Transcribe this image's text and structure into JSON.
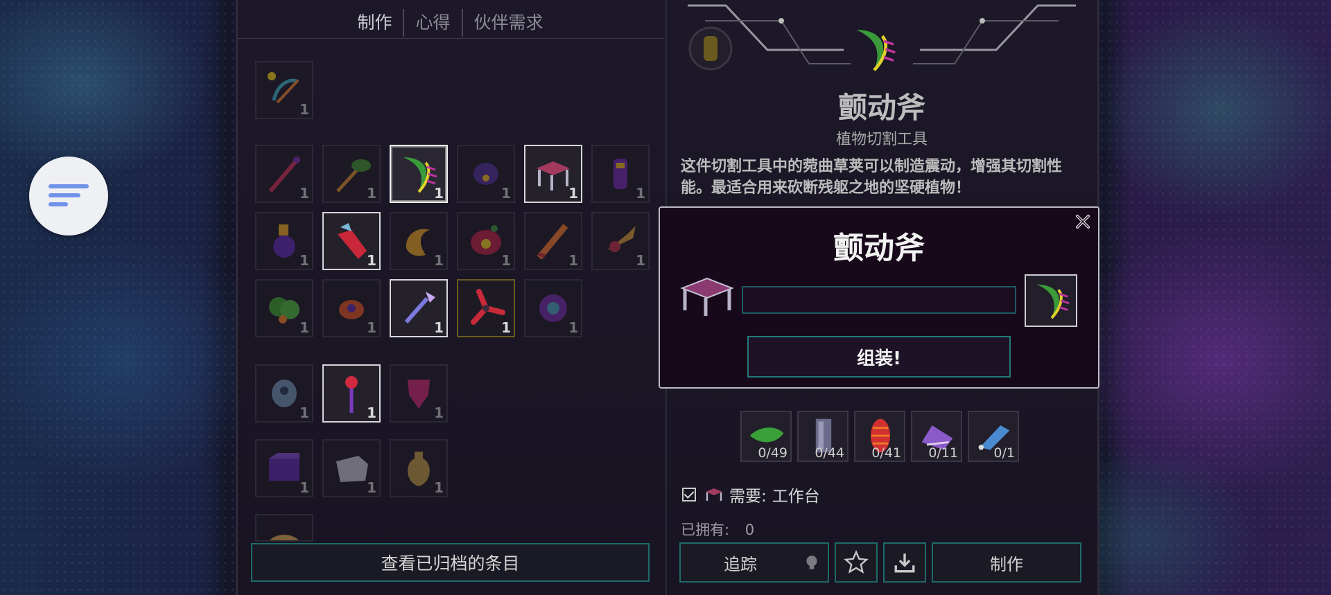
{
  "tabs": [
    {
      "label": "制作",
      "active": true
    },
    {
      "label": "心得",
      "active": false
    },
    {
      "label": "伙伴需求",
      "active": false
    }
  ],
  "recipe_grid": {
    "slots": [
      {
        "icon": "bow-icon",
        "count": "1"
      },
      {
        "icon": "staff-icon",
        "count": "1"
      },
      {
        "icon": "pickaxe-icon",
        "count": "1"
      },
      {
        "icon": "tremor-axe-icon",
        "count": "1"
      },
      {
        "icon": "purple-flower-icon",
        "count": "1"
      },
      {
        "icon": "workbench-icon",
        "count": "1"
      },
      {
        "icon": "purple-totem-icon",
        "count": "1"
      },
      {
        "icon": "purple-lantern-icon",
        "count": "1"
      },
      {
        "icon": "red-boot-icon",
        "count": "1"
      },
      {
        "icon": "gold-crescent-icon",
        "count": "1"
      },
      {
        "icon": "red-mask-icon",
        "count": "1"
      },
      {
        "icon": "orange-sword-icon",
        "count": "1"
      },
      {
        "icon": "drill-icon",
        "count": "1"
      },
      {
        "icon": "green-bush-icon",
        "count": "1"
      },
      {
        "icon": "red-crab-icon",
        "count": "1"
      },
      {
        "icon": "crystal-wand-icon",
        "count": "1"
      },
      {
        "icon": "red-shuriken-icon",
        "count": "1"
      },
      {
        "icon": "purple-orb-icon",
        "count": "1"
      },
      {
        "icon": "ghost-statue-icon",
        "count": "1"
      },
      {
        "icon": "red-scepter-icon",
        "count": "1"
      },
      {
        "icon": "shield-banner-icon",
        "count": "1"
      },
      {
        "icon": "purple-crate-icon",
        "count": "1"
      },
      {
        "icon": "stone-block-icon",
        "count": "1"
      },
      {
        "icon": "clay-vase-icon",
        "count": "1"
      },
      {
        "icon": "bread-icon",
        "count": ""
      }
    ]
  },
  "archive_button": "查看已归档的条目",
  "item": {
    "name": "颤动斧",
    "category": "植物切割工具",
    "description": "这件切割工具中的菀曲草荚可以制造震动，增强其切割性能。最适合用来砍断残躯之地的坚硬植物！"
  },
  "materials": [
    {
      "icon": "green-pod-icon",
      "count": "0/49"
    },
    {
      "icon": "metal-plate-icon",
      "count": "0/44"
    },
    {
      "icon": "red-cocoon-icon",
      "count": "0/41"
    },
    {
      "icon": "purple-shell-icon",
      "count": "0/11"
    },
    {
      "icon": "blue-feather-icon",
      "count": "0/1"
    }
  ],
  "requirement": {
    "label": "需要:",
    "station": "工作台",
    "met": true
  },
  "owned": {
    "label": "已拥有:",
    "value": "0"
  },
  "actions": {
    "track": "追踪",
    "craft": "制作"
  },
  "modal": {
    "title": "颤动斧",
    "progress": 0,
    "assemble_label": "组装!"
  },
  "colors": {
    "accent_teal": "#1f6a68",
    "panel_bg": "#181422",
    "menu_blue": "#6f93e8"
  }
}
